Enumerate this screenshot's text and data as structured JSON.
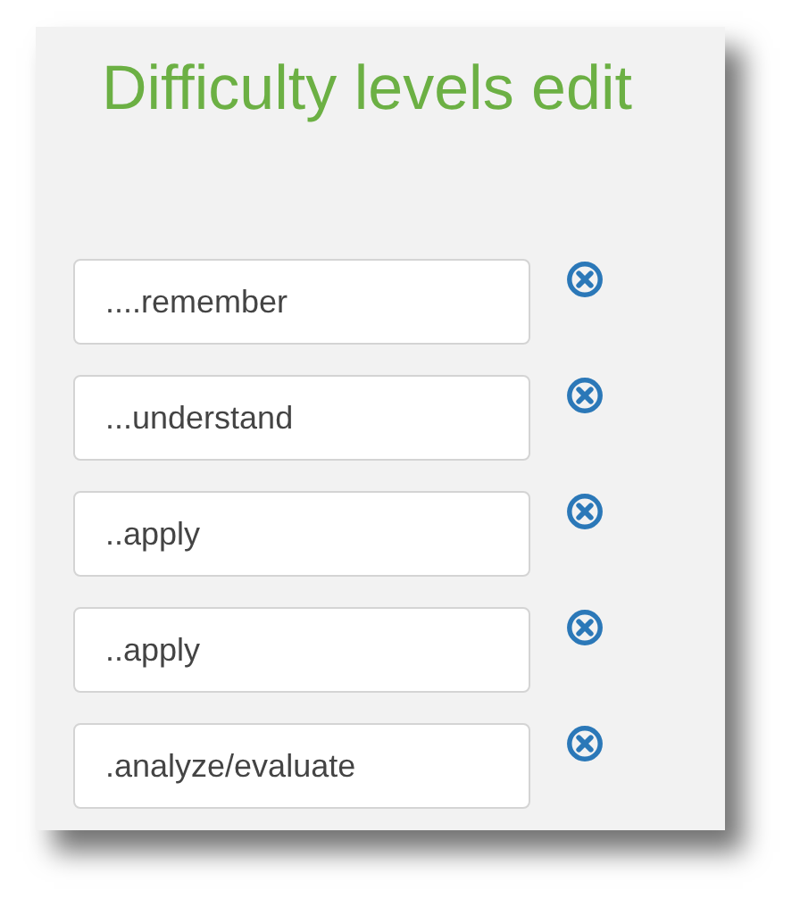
{
  "title": "Difficulty levels edit",
  "levels": [
    {
      "value": "....remember"
    },
    {
      "value": "...understand"
    },
    {
      "value": "..apply"
    },
    {
      "value": "..apply"
    },
    {
      "value": ".analyze/evaluate"
    }
  ]
}
